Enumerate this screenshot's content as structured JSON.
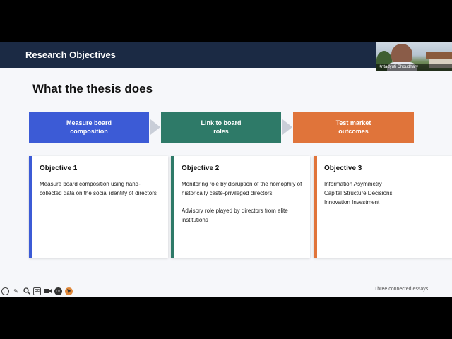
{
  "header": {
    "title": "Research Objectives"
  },
  "video": {
    "participant_name": "Kritadyuti Choudhary"
  },
  "subtitle": "What the thesis does",
  "process": [
    {
      "label": "Measure board composition",
      "color": "#3c5bd6"
    },
    {
      "label": "Link to board roles",
      "color": "#2e7a68"
    },
    {
      "label": "Test market outcomes",
      "color": "#e0743a"
    }
  ],
  "objectives": [
    {
      "title": "Objective 1",
      "color": "#3c5bd6",
      "text": "Measure board composition using hand-collected data on the social identity of directors"
    },
    {
      "title": "Objective 2",
      "color": "#2e7a68",
      "text1": "Monitoring role by disruption of the homophily of historically caste-privileged directors",
      "text2": "Advisory role played by directors from elite institutions"
    },
    {
      "title": "Objective 3",
      "color": "#e0743a",
      "lines": [
        "Information Asymmetry",
        "Capital Structure Decisions",
        "Innovation Investment"
      ]
    }
  ],
  "footer_note": "Three connected essays",
  "toolbar": {
    "icons": [
      "back-arrow-icon",
      "pen-icon",
      "magnifier-icon",
      "closed-caption-icon",
      "video-icon",
      "more-options-icon",
      "pointer-icon"
    ],
    "cc_label": "CC"
  }
}
